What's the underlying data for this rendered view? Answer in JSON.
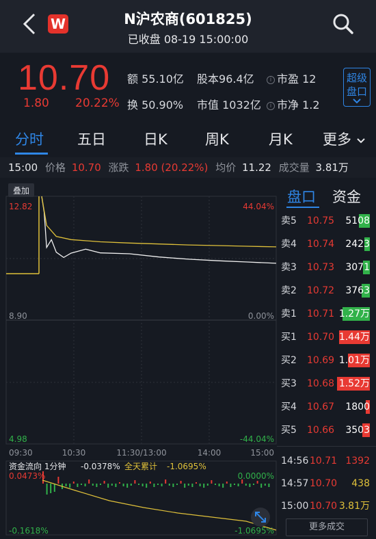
{
  "header": {
    "title": "N沪农商(601825)",
    "subtitle": "已收盘 08-19 15:00:00",
    "logo_letter": "W"
  },
  "quote": {
    "price": "10.70",
    "change": "1.80",
    "change_pct": "20.22%",
    "amount_label": "额",
    "amount": "55.10亿",
    "turnover_label": "换",
    "turnover": "50.90%",
    "capital_label": "股本",
    "capital": "96.4亿",
    "mktcap_label": "市值",
    "mktcap": "1032亿",
    "pe_label": "市盈",
    "pe": "12",
    "pb_label": "市净",
    "pb": "1.2",
    "super_btn_line1": "超级",
    "super_btn_line2": "盘口"
  },
  "tabs": [
    "分时",
    "五日",
    "日K",
    "周K",
    "月K",
    "更多"
  ],
  "infobar": {
    "time": "15:00",
    "price_label": "价格",
    "price": "10.70",
    "change_label": "涨跌",
    "change": "1.80 (20.22%)",
    "avg_label": "均价",
    "avg": "11.22",
    "vol_label": "成交量",
    "vol": "3.81万"
  },
  "chart": {
    "overlay_label": "叠加",
    "y_top": "12.82",
    "y_mid": "8.90",
    "y_bottom": "4.98",
    "pct_top": "44.04%",
    "pct_mid": "0.00%",
    "pct_bottom": "-44.04%",
    "x_ticks": [
      "09:30",
      "10:30",
      "11:30/13:00",
      "14:00",
      "15:00"
    ],
    "flow_title": "资金流向 1分钟",
    "flow_value": "-0.0378%",
    "flow_cum_label": "全天累计",
    "flow_cum": "-1.0695%",
    "flow_top_left": "0.0473%",
    "flow_top_right": "0.0000%",
    "flow_bottom_left": "-0.1618%",
    "flow_bottom_right": "-1.0695%"
  },
  "chart_data": {
    "type": "line",
    "title": "",
    "x": [
      "09:30",
      "09:35",
      "09:45",
      "10:00",
      "10:30",
      "11:00",
      "11:30/13:00",
      "13:30",
      "14:00",
      "14:30",
      "15:00"
    ],
    "series": [
      {
        "values": [
          12.82,
          11.2,
          11.05,
          11.02,
          11.03,
          11.0,
          10.9,
          10.83,
          10.78,
          10.74,
          10.7
        ]
      },
      {
        "values": [
          12.82,
          11.9,
          11.55,
          11.45,
          11.38,
          11.34,
          11.31,
          11.28,
          11.26,
          11.24,
          11.22
        ]
      }
    ],
    "ylim": [
      4.98,
      12.82
    ],
    "grid": true
  },
  "right_panel": {
    "tab_orderbook": "盘口",
    "tab_funds": "资金",
    "orderbook": [
      {
        "label": "卖5",
        "price": "10.75",
        "volume": "5108",
        "bar": "green"
      },
      {
        "label": "卖4",
        "price": "10.74",
        "volume": "2423",
        "bar": "green"
      },
      {
        "label": "卖3",
        "price": "10.73",
        "volume": "3071",
        "bar": "green"
      },
      {
        "label": "卖2",
        "price": "10.72",
        "volume": "3763",
        "bar": "green"
      },
      {
        "label": "卖1",
        "price": "10.71",
        "volume": "1.27万",
        "bar": "green"
      },
      {
        "label": "买1",
        "price": "10.70",
        "volume": "1.44万",
        "bar": "red"
      },
      {
        "label": "买2",
        "price": "10.69",
        "volume": "1.01万",
        "bar": "red"
      },
      {
        "label": "买3",
        "price": "10.68",
        "volume": "1.52万",
        "bar": "red"
      },
      {
        "label": "买4",
        "price": "10.67",
        "volume": "1800",
        "bar": "red"
      },
      {
        "label": "买5",
        "price": "10.66",
        "volume": "3503",
        "bar": "red"
      }
    ],
    "trades": [
      {
        "time": "14:56",
        "price": "10.71",
        "volume": "1392",
        "color": "#e83a33"
      },
      {
        "time": "14:57",
        "price": "10.70",
        "volume": "438",
        "color": "#e0c13a"
      },
      {
        "time": "15:00",
        "price": "10.70",
        "volume": "3.81万",
        "color": "#e0c13a"
      }
    ],
    "more_trades": "更多成交"
  },
  "colors": {
    "up": "#e83a33",
    "down": "#31b24a",
    "accent": "#2f86e6",
    "avg_line": "#e0c13a",
    "background": "#161a22"
  }
}
